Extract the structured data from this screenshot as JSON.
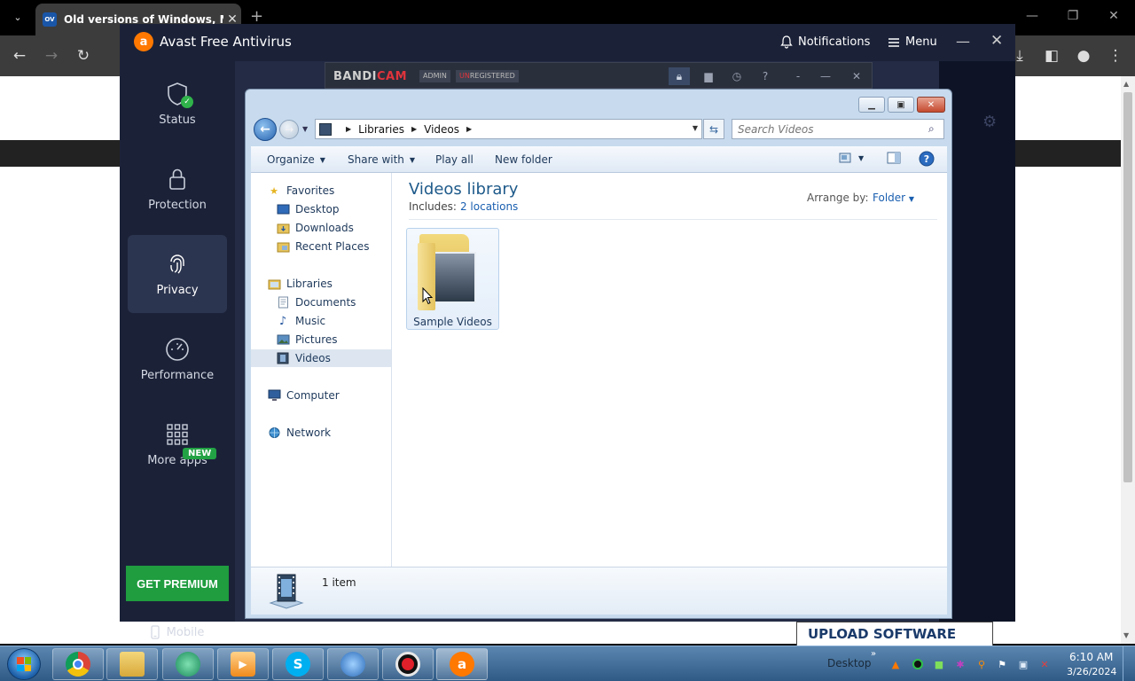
{
  "chrome": {
    "tab_title": "Old versions of Windows, Mac",
    "tab_favicon": "OV",
    "tab_close": "✕",
    "new_tab": "+",
    "minimize": "—",
    "restore": "❐",
    "close": "✕"
  },
  "avast": {
    "title": "Avast Free Antivirus",
    "logo": "a",
    "notifications": "Notifications",
    "menu": "Menu",
    "minimize": "—",
    "close": "✕",
    "sidebar": {
      "status": "Status",
      "protection": "Protection",
      "privacy": "Privacy",
      "performance": "Performance",
      "more_apps": "More apps",
      "new_badge": "NEW"
    },
    "get_premium": "GET PREMIUM",
    "mobile": "Mobile"
  },
  "bandicam": {
    "logo_a": "BANDI",
    "logo_b": "CAM",
    "admin": "ADMIN",
    "unregistered_un": "UN",
    "unregistered_rest": "REGISTERED",
    "help": "?",
    "dash": "-",
    "minimize": "—",
    "close": "✕"
  },
  "explorer": {
    "address": {
      "part1": "Libraries",
      "part2": "Videos"
    },
    "search_placeholder": "Search Videos",
    "commands": {
      "organize": "Organize",
      "share_with": "Share with",
      "play_all": "Play all",
      "new_folder": "New folder"
    },
    "nav": {
      "favorites": "Favorites",
      "desktop": "Desktop",
      "downloads": "Downloads",
      "recent_places": "Recent Places",
      "libraries": "Libraries",
      "documents": "Documents",
      "music": "Music",
      "pictures": "Pictures",
      "videos": "Videos",
      "computer": "Computer",
      "network": "Network"
    },
    "library_title": "Videos library",
    "includes_label": "Includes:",
    "includes_link": "2 locations",
    "arrange_label": "Arrange by:",
    "arrange_value": "Folder",
    "folder_name": "Sample Videos",
    "item_count": "1 item"
  },
  "upload_label": "UPLOAD SOFTWARE",
  "taskbar": {
    "desktop": "Desktop",
    "time": "6:10 AM",
    "date": "3/26/2024"
  }
}
